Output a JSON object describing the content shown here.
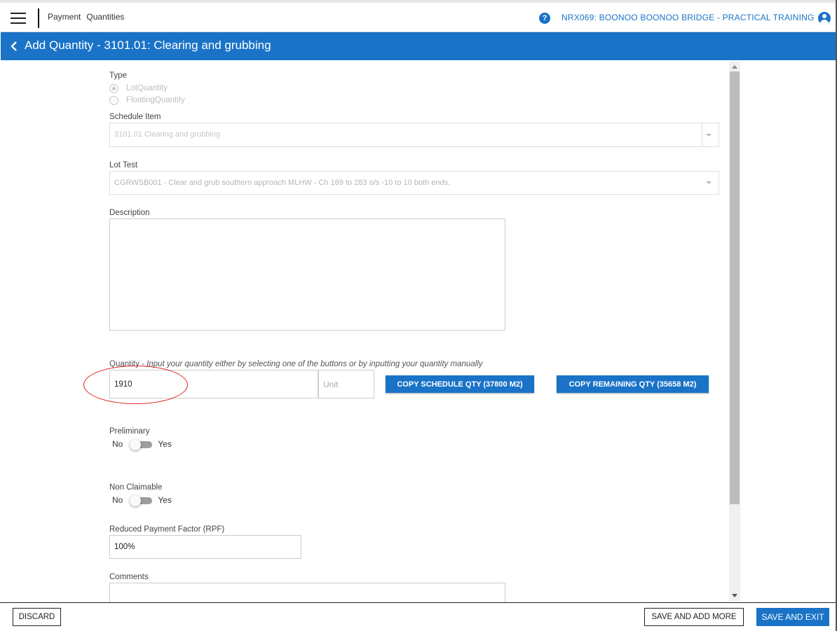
{
  "header": {
    "breadcrumbs": [
      "Payment",
      "Quantities"
    ],
    "help_glyph": "?",
    "project": "NRX069: BOONOO BOONOO BRIDGE - PRACTICAL TRAINING"
  },
  "titlebar": {
    "title": "Add Quantity - 3101.01: Clearing and grubbing"
  },
  "form": {
    "type": {
      "label": "Type",
      "options": [
        {
          "label": "LotQuantity",
          "selected": true
        },
        {
          "label": "FloatingQuantity",
          "selected": false
        }
      ]
    },
    "schedule_item": {
      "label": "Schedule Item",
      "value": "3101.01 Clearing and grubbing"
    },
    "lot_test": {
      "label": "Lot Test",
      "value": "CGRWSB001 - Clear and grub southern approach MLHW - Ch 169 to 283 o/s -10 to 10 both ends."
    },
    "description": {
      "label": "Description",
      "value": ""
    },
    "quantity": {
      "label": "Quantity",
      "hint_sep": " - ",
      "hint": "Input your quantity either by selecting one of the buttons or by inputting your quantity manually",
      "value": "1910",
      "unit_placeholder": "Unit",
      "copy_schedule_label": "COPY SCHEDULE QTY (37800 M2)",
      "copy_remaining_label": "COPY REMAINING QTY (35658 M2)"
    },
    "preliminary": {
      "label": "Preliminary",
      "no": "No",
      "yes": "Yes",
      "enabled": false
    },
    "non_claimable": {
      "label": "Non Claimable",
      "no": "No",
      "yes": "Yes",
      "enabled": false
    },
    "rpf": {
      "label": "Reduced Payment Factor (RPF)",
      "value": "100%"
    },
    "comments": {
      "label": "Comments",
      "value": ""
    }
  },
  "footer": {
    "discard_label": "DISCARD",
    "save_add_more_label": "SAVE AND ADD MORE",
    "save_exit_label": "SAVE AND EXIT"
  },
  "colors": {
    "accent": "#1a73c7",
    "annotation": "#dd2222"
  }
}
